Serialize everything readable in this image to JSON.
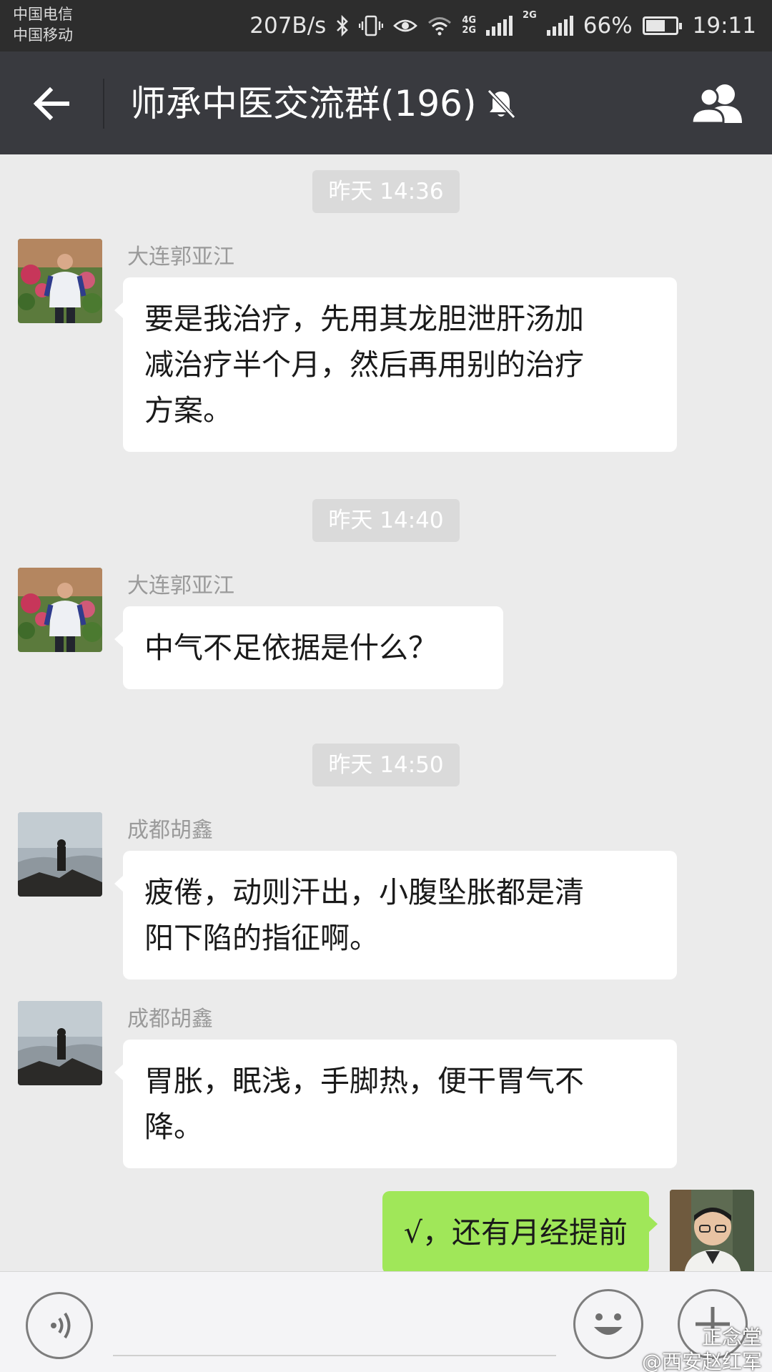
{
  "status_bar": {
    "carrier_1": "中国电信",
    "carrier_2": "中国移动",
    "net_speed": "207B/s",
    "net_4g": "4G",
    "net_2g": "2G",
    "net_2g_b": "2G",
    "battery_percent": "66%",
    "battery_level": 0.66,
    "time": "19:11"
  },
  "title_bar": {
    "title": "师承中医交流群(196)",
    "back_icon": "arrow-left-icon",
    "mute_icon": "bell-off-icon",
    "members_icon": "group-icon"
  },
  "messages": [
    {
      "type": "time",
      "text": "昨天 14:36"
    },
    {
      "type": "incoming",
      "sender": "大连郭亚江",
      "lines": [
        "要是我治疗，先用其龙胆泄肝汤加",
        "减治疗半个月，然后再用别的治疗",
        "方案。"
      ]
    },
    {
      "type": "time",
      "text": "昨天 14:40"
    },
    {
      "type": "incoming",
      "sender": "大连郭亚江",
      "lines": [
        "中气不足依据是什么？"
      ]
    },
    {
      "type": "time",
      "text": "昨天 14:50"
    },
    {
      "type": "incoming",
      "sender": "成都胡鑫",
      "lines": [
        "疲倦，动则汗出，小腹坠胀都是清",
        "阳下陷的指征啊。"
      ]
    },
    {
      "type": "incoming",
      "sender": "成都胡鑫",
      "lines": [
        "胃胀，眠浅，手脚热，便干胃气不",
        "降。"
      ]
    },
    {
      "type": "outgoing",
      "lines": [
        "√，还有月经提前"
      ]
    }
  ],
  "input_bar": {
    "voice_icon": "voice-icon",
    "emoji_icon": "emoji-icon",
    "plus_icon": "plus-icon"
  },
  "watermark": {
    "line1": "正念堂",
    "line2": "@西安赵红军"
  },
  "colors": {
    "title_bg": "#393a3f",
    "chat_bg": "#ebebeb",
    "bubble_own": "#a0e759"
  }
}
